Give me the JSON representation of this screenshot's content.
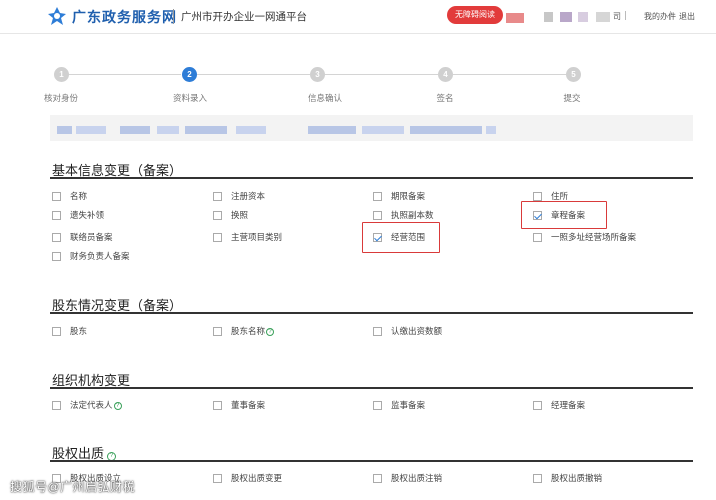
{
  "header": {
    "logo_text": "广东政务服务网",
    "subtitle": "广州市开办企业一网通平台",
    "access_button": "无障碍阅读",
    "user_suffix": "司",
    "my_office": "我的办件",
    "logout": "退出"
  },
  "steps": [
    {
      "num": "1",
      "label": "核对身份",
      "active": false
    },
    {
      "num": "2",
      "label": "资料录入",
      "active": true
    },
    {
      "num": "3",
      "label": "信息确认",
      "active": false
    },
    {
      "num": "4",
      "label": "签名",
      "active": false
    },
    {
      "num": "5",
      "label": "提交",
      "active": false
    }
  ],
  "sections": {
    "basic": {
      "title": "基本信息变更（备案）",
      "items": [
        "名称",
        "注册资本",
        "期限备案",
        "住所",
        "遗失补领",
        "换照",
        "执照副本数",
        "章程备案",
        "联络员备案",
        "主营项目类别",
        "经营范围",
        "一照多址经营场所备案",
        "财务负责人备案"
      ]
    },
    "shareholder": {
      "title": "股东情况变更（备案）",
      "items": [
        "股东",
        "股东名称",
        "认缴出资数额"
      ]
    },
    "org": {
      "title": "组织机构变更",
      "items": [
        "法定代表人",
        "董事备案",
        "监事备案",
        "经理备案"
      ]
    },
    "equity": {
      "title": "股权出质",
      "items": [
        "股权出质设立",
        "股权出质变更",
        "股权出质注销",
        "股权出质撤销"
      ]
    }
  },
  "watermark": "搜狐号@广州启弘财税",
  "colors": {
    "brand": "#1f5fae",
    "accent": "#2e7dd7",
    "highlight": "#d93a3a"
  }
}
